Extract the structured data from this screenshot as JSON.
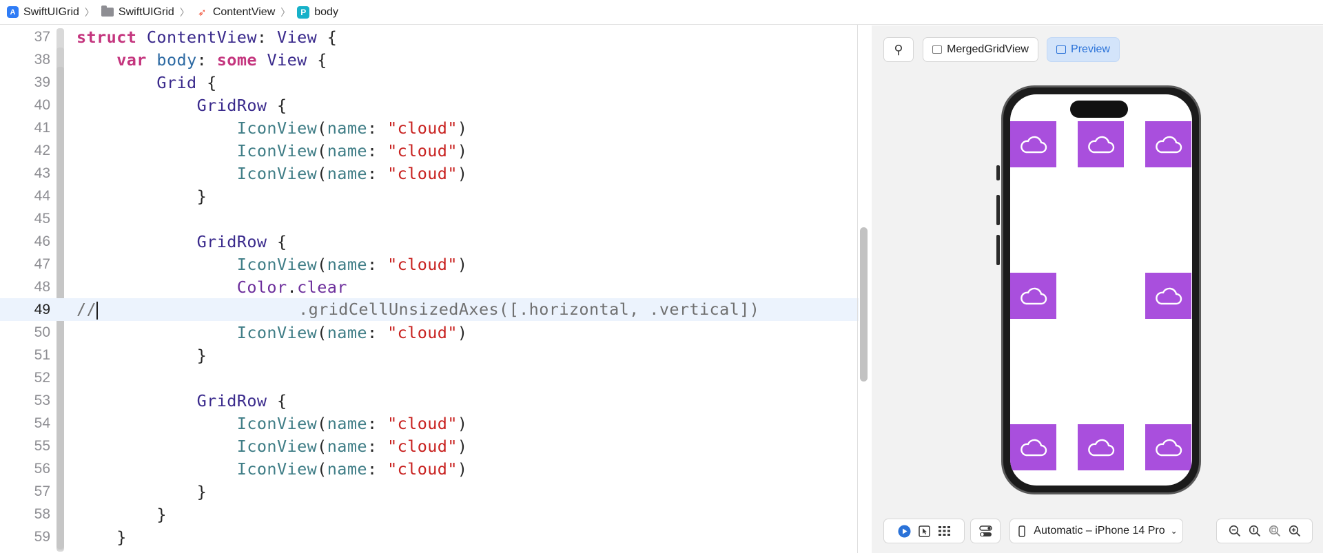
{
  "breadcrumb": {
    "items": [
      {
        "label": "SwiftUIGrid",
        "icon": "app-icon"
      },
      {
        "label": "SwiftUIGrid",
        "icon": "folder-icon"
      },
      {
        "label": "ContentView",
        "icon": "swift-file-icon"
      },
      {
        "label": "body",
        "icon": "property-icon"
      }
    ],
    "separator": "〉"
  },
  "editor": {
    "current_line": 49,
    "lines": [
      {
        "n": "37"
      },
      {
        "n": "38"
      },
      {
        "n": "39"
      },
      {
        "n": "40"
      },
      {
        "n": "41"
      },
      {
        "n": "42"
      },
      {
        "n": "43"
      },
      {
        "n": "44"
      },
      {
        "n": "45"
      },
      {
        "n": "46"
      },
      {
        "n": "47"
      },
      {
        "n": "48"
      },
      {
        "n": "49"
      },
      {
        "n": "50"
      },
      {
        "n": "51"
      },
      {
        "n": "52"
      },
      {
        "n": "53"
      },
      {
        "n": "54"
      },
      {
        "n": "55"
      },
      {
        "n": "56"
      },
      {
        "n": "57"
      },
      {
        "n": "58"
      },
      {
        "n": "59"
      }
    ],
    "tokens": {
      "struct": "struct",
      "ContentView": "ContentView",
      "colon": ":",
      "View": "View",
      "brace_open": "{",
      "brace_close": "}",
      "var": "var",
      "body": "body",
      "some": "some",
      "Grid": "Grid",
      "GridRow": "GridRow",
      "IconView": "IconView",
      "paren_open": "(",
      "paren_close": ")",
      "name": "name",
      "cloud": "\"cloud\"",
      "Color": "Color",
      "dot": ".",
      "clear": "clear",
      "comment": "//",
      "modifier": ".gridCellUnsizedAxes([.horizontal, .vertical])"
    }
  },
  "preview": {
    "pin_label": "",
    "view_button": "MergedGridView",
    "preview_button": "Preview",
    "device": "Automatic – iPhone 14 Pro",
    "colors": {
      "cell": "#a94fdd",
      "accent": "#2a72d8"
    }
  }
}
